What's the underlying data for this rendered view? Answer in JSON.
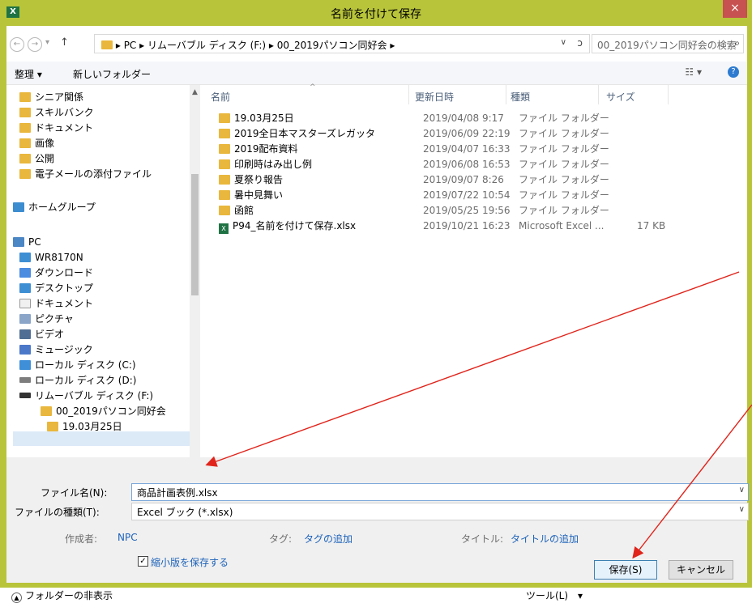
{
  "window": {
    "title": "名前を付けて保存",
    "app_icon": "excel-icon",
    "close_label": "×"
  },
  "address": {
    "back_icon": "←",
    "forward_icon": "→",
    "history_icon": "▾",
    "up_icon": "↑",
    "breadcrumbs": [
      "PC",
      "リムーバブル ディスク (F:)",
      "00_2019パソコン同好会"
    ],
    "separator": "▸",
    "dropdown_icon": "∨",
    "refresh_icon": "ↄ"
  },
  "search": {
    "placeholder": "00_2019パソコン同好会の検索",
    "icon": "⌕"
  },
  "toolbar": {
    "organize_label": "整理 ▾",
    "new_folder_label": "新しいフォルダー",
    "view_icon": "☷ ▾",
    "help_icon": "?"
  },
  "nav": {
    "items": [
      {
        "label": "シニア関係",
        "icon": "folder"
      },
      {
        "label": "スキルバンク",
        "icon": "folder"
      },
      {
        "label": "ドキュメント",
        "icon": "folder"
      },
      {
        "label": "画像",
        "icon": "folder"
      },
      {
        "label": "公開",
        "icon": "folder"
      },
      {
        "label": "電子メールの添付ファイル",
        "icon": "folder"
      },
      {
        "label": "ホームグループ",
        "icon": "homegroup"
      },
      {
        "label": "PC",
        "icon": "pc"
      },
      {
        "label": "WR8170N",
        "icon": "network"
      },
      {
        "label": "ダウンロード",
        "icon": "download"
      },
      {
        "label": "デスクトップ",
        "icon": "desktop"
      },
      {
        "label": "ドキュメント",
        "icon": "documents"
      },
      {
        "label": "ピクチャ",
        "icon": "pictures"
      },
      {
        "label": "ビデオ",
        "icon": "videos"
      },
      {
        "label": "ミュージック",
        "icon": "music"
      },
      {
        "label": "ローカル ディスク (C:)",
        "icon": "drive-c"
      },
      {
        "label": "ローカル ディスク (D:)",
        "icon": "drive"
      },
      {
        "label": "リムーバブル ディスク (F:)",
        "icon": "drive"
      },
      {
        "label": "00_2019パソコン同好会",
        "icon": "folder"
      },
      {
        "label": "19.03月25日",
        "icon": "folder"
      }
    ]
  },
  "files": {
    "columns": [
      "名前",
      "更新日時",
      "種類",
      "サイズ"
    ],
    "rows": [
      {
        "name": "19.03月25日",
        "date": "2019/04/08 9:17",
        "type": "ファイル フォルダー",
        "size": "",
        "icon": "folder"
      },
      {
        "name": "2019全日本マスターズレガッタ",
        "date": "2019/06/09 22:19",
        "type": "ファイル フォルダー",
        "size": "",
        "icon": "folder"
      },
      {
        "name": "2019配布資料",
        "date": "2019/04/07 16:33",
        "type": "ファイル フォルダー",
        "size": "",
        "icon": "folder"
      },
      {
        "name": "印刷時はみ出し例",
        "date": "2019/06/08 16:53",
        "type": "ファイル フォルダー",
        "size": "",
        "icon": "folder"
      },
      {
        "name": "夏祭り報告",
        "date": "2019/09/07 8:26",
        "type": "ファイル フォルダー",
        "size": "",
        "icon": "folder"
      },
      {
        "name": "暑中見舞い",
        "date": "2019/07/22 10:54",
        "type": "ファイル フォルダー",
        "size": "",
        "icon": "folder"
      },
      {
        "name": "函館",
        "date": "2019/05/25 19:56",
        "type": "ファイル フォルダー",
        "size": "",
        "icon": "folder"
      },
      {
        "name": "P94_名前を付けて保存.xlsx",
        "date": "2019/10/21 16:23",
        "type": "Microsoft Excel ...",
        "size": "17 KB",
        "icon": "excel-file"
      }
    ]
  },
  "form": {
    "filename_label": "ファイル名(N):",
    "filename_value": "商品計画表例.xlsx",
    "filetype_label": "ファイルの種類(T):",
    "filetype_value": "Excel ブック (*.xlsx)",
    "author_label": "作成者:",
    "author_value": "NPC",
    "tags_label": "タグ:",
    "tags_value": "タグの追加",
    "title_label": "タイトル:",
    "title_value": "タイトルの追加",
    "thumbnail_label": "縮小版を保存する",
    "thumbnail_checked": true
  },
  "footer": {
    "hide_folders_label": "フォルダーの非表示",
    "tools_label": "ツール(L)　▾",
    "save_label": "保存(S)",
    "cancel_label": "キャンセル"
  },
  "colors": {
    "window_frame": "#b8c43a",
    "annotation_arrow": "#e0241b",
    "link": "#1c62b9",
    "close": "#c75050"
  }
}
